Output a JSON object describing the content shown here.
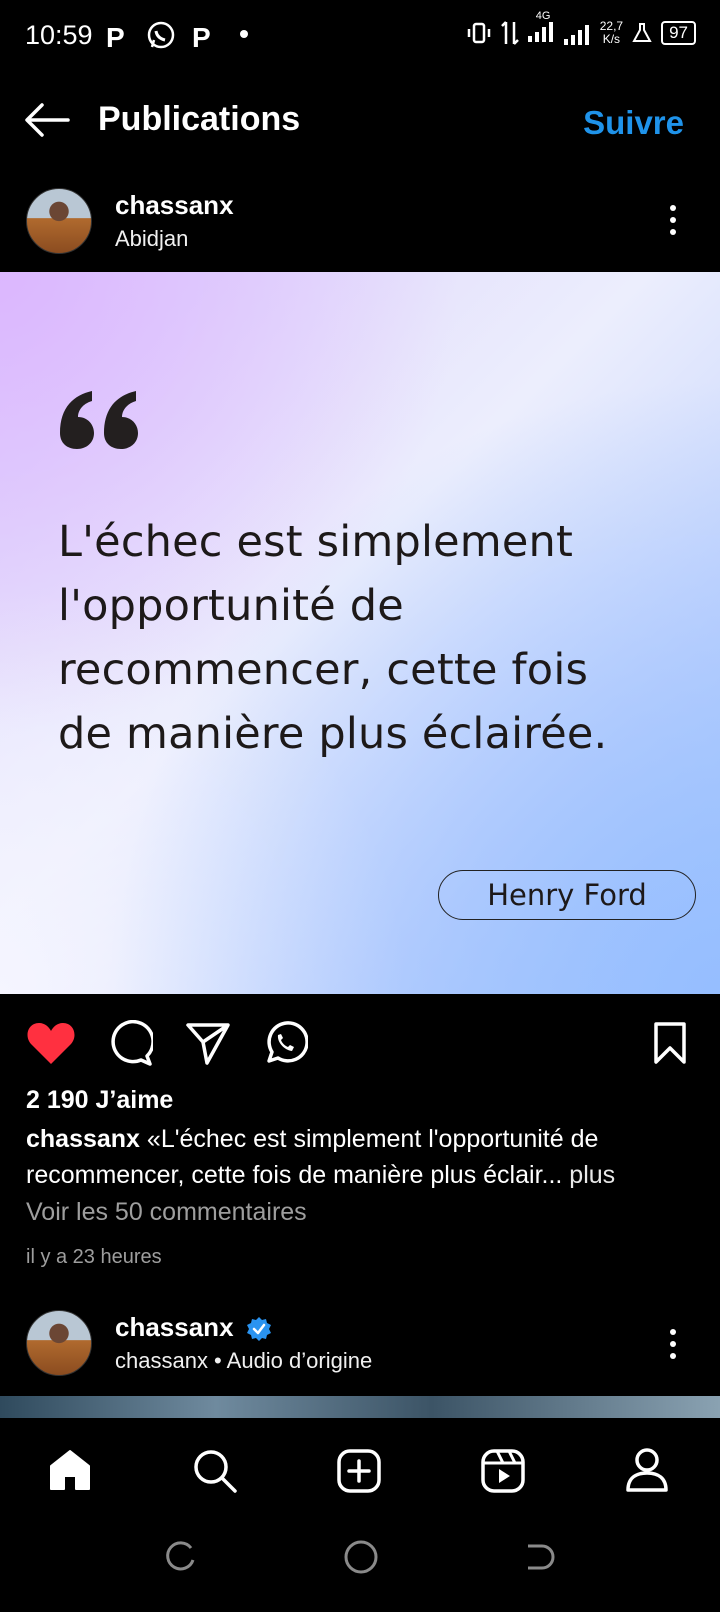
{
  "status_bar": {
    "time": "10:59",
    "left_icons": [
      "p-icon",
      "whatsapp-icon",
      "p-icon",
      "dot"
    ],
    "net_speed_value": "22,7",
    "net_speed_unit": "K/s",
    "network": "4G",
    "battery": "97"
  },
  "header": {
    "title": "Publications",
    "follow_label": "Suivre"
  },
  "post": {
    "username": "chassanx",
    "location": "Abidjan",
    "quote_lines": [
      "L'échec est simplement",
      "l'opportunité de",
      "recommencer, cette fois",
      "de manière plus éclairée."
    ],
    "author": "Henry Ford",
    "likes": "2 190 J’aime",
    "caption_user": "chassanx",
    "caption_text": " «L'échec est simplement l'opportunité de recommencer, cette fois de manière plus éclair...",
    "caption_more": " plus",
    "comments_link": "Voir les 50 commentaires",
    "time_ago": "il y a 23 heures"
  },
  "next_post": {
    "username": "chassanx",
    "audio": "chassanx • Audio d’origine"
  },
  "colors": {
    "accent": "#1f93ea",
    "like": "#ff3040",
    "background": "#000000"
  }
}
